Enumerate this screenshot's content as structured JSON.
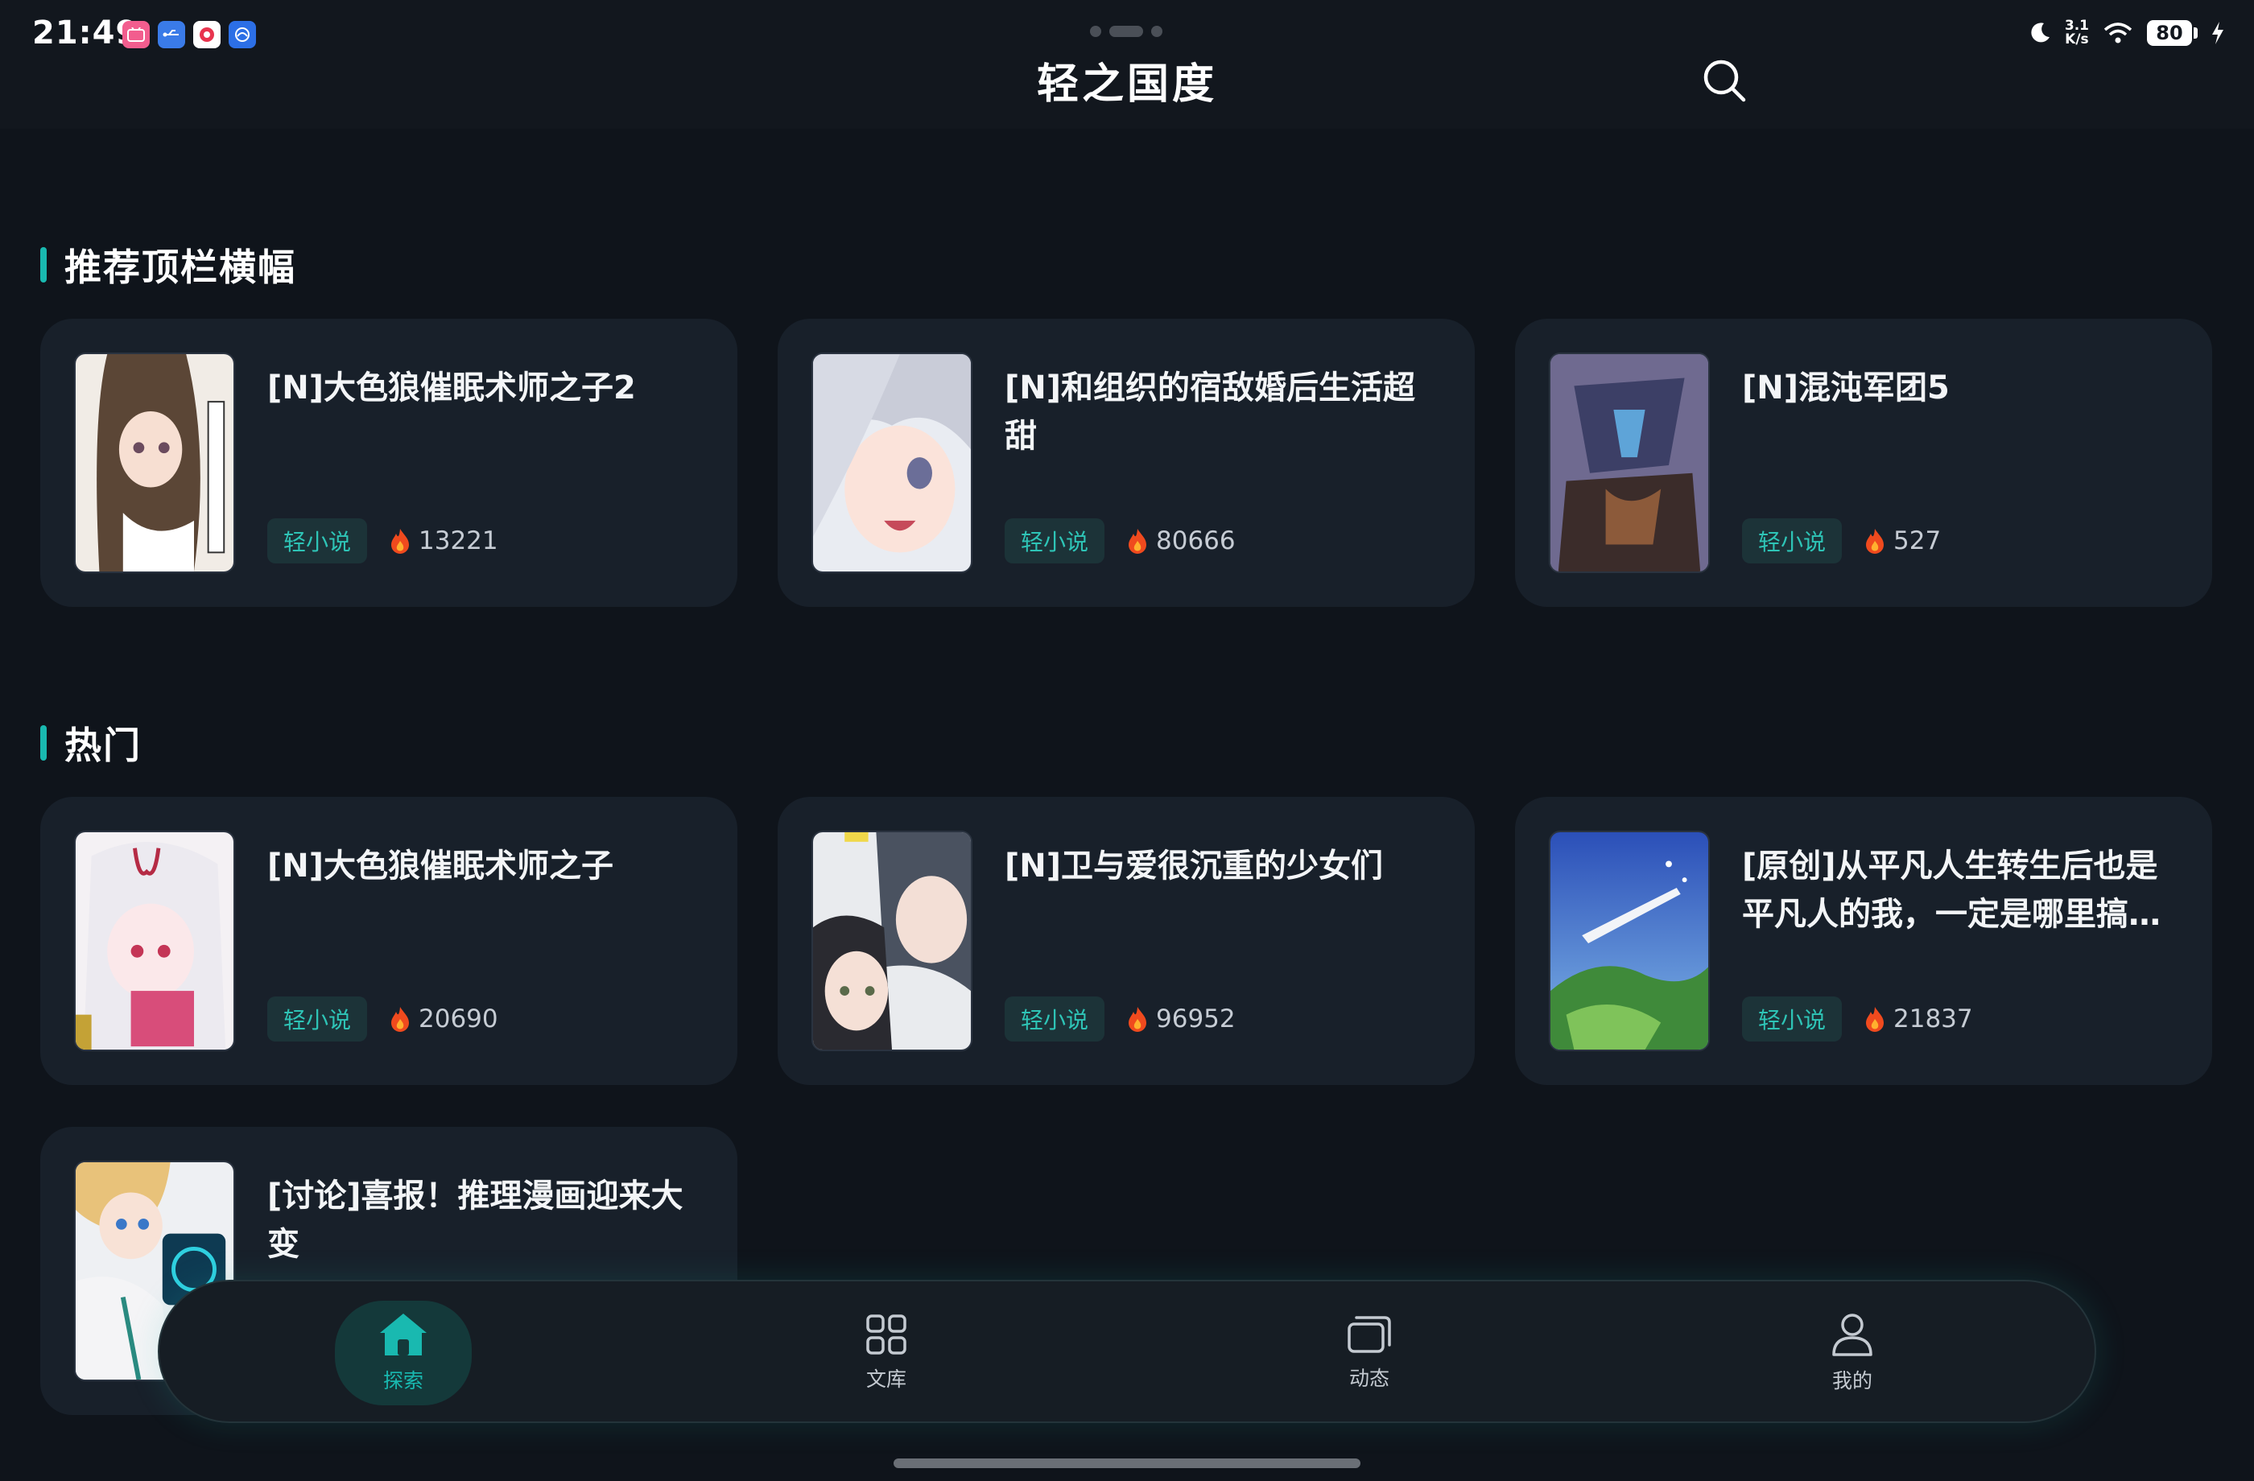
{
  "status_bar": {
    "time": "21:49",
    "network_speed_top": "3.1",
    "network_speed_unit": "K/s",
    "battery": "80",
    "app_icons": [
      "bilibili-icon",
      "usb-icon",
      "gallery-icon",
      "browser-icon"
    ]
  },
  "header": {
    "title": "轻之国度",
    "search_icon": "search-icon"
  },
  "sections": [
    {
      "title": "推荐顶栏横幅",
      "items": [
        {
          "title": "[N]大色狼催眠术师之子2",
          "tag": "轻小说",
          "heat": "13221"
        },
        {
          "title": "[N]和组织的宿敌婚后生活超甜",
          "tag": "轻小说",
          "heat": "80666"
        },
        {
          "title": "[N]混沌军团5",
          "tag": "轻小说",
          "heat": "527"
        }
      ]
    },
    {
      "title": "热门",
      "items": [
        {
          "title": "[N]大色狼催眠术师之子",
          "tag": "轻小说",
          "heat": "20690"
        },
        {
          "title": "[N]卫与爱很沉重的少女们",
          "tag": "轻小说",
          "heat": "96952"
        },
        {
          "title": "[原创]从平凡人生转生后也是平凡人的我，一定是哪里搞错了",
          "tag": "轻小说",
          "heat": "21837"
        },
        {
          "title": "[讨论]喜报！推理漫画迎来大变"
        }
      ]
    }
  ],
  "bottom_nav": {
    "items": [
      {
        "label": "探索",
        "icon": "home-icon",
        "active": true
      },
      {
        "label": "文库",
        "icon": "grid-icon",
        "active": false
      },
      {
        "label": "动态",
        "icon": "cards-icon",
        "active": false
      },
      {
        "label": "我的",
        "icon": "user-icon",
        "active": false
      }
    ]
  },
  "colors": {
    "background": "#0f141b",
    "card": "#18202a",
    "accent": "#19b9b0",
    "tag_text": "#2ec4b6",
    "flame": "#f04a1e"
  }
}
